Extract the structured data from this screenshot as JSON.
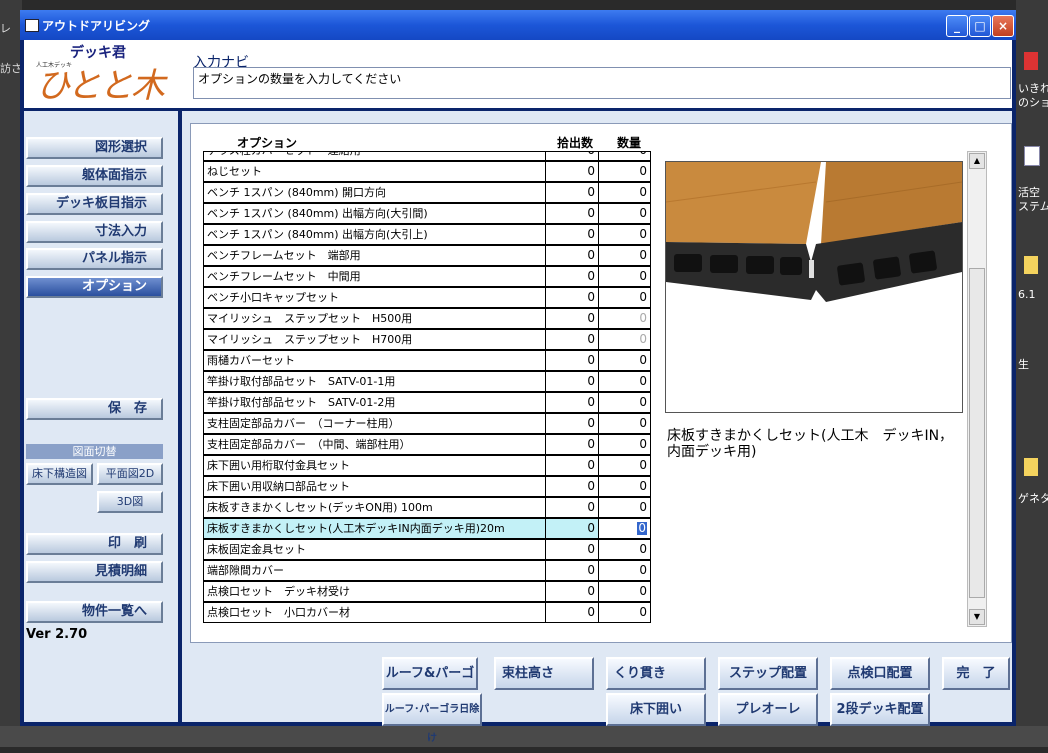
{
  "desktop": {
    "left_labels": [
      "レ",
      "訪さ"
    ],
    "right_labels": [
      "いきれ",
      "のショ",
      "活空",
      "ステム",
      "6.1",
      "生",
      "ゲネタ"
    ]
  },
  "window": {
    "title": "アウトドアリビング",
    "controls": {
      "minimize": "_",
      "maximize": "□",
      "close": "×"
    }
  },
  "logo": {
    "product": "デッキ君",
    "sub": "人工木デッキ",
    "brand": "ひとと木"
  },
  "navi": {
    "title": "入力ナビ",
    "message": "オプションの数量を入力してください"
  },
  "sidebar": {
    "buttons": [
      "図形選択",
      "躯体面指示",
      "デッキ板目指示",
      "寸法入力",
      "パネル指示",
      "オプション"
    ],
    "active": "オプション",
    "save": "保　存",
    "view_label": "図面切替",
    "view_buttons": [
      "床下構造図",
      "平面図2D",
      "3D図"
    ],
    "print": "印　刷",
    "estimate": "見積明細",
    "list": "物件一覧へ",
    "version": "Ver 2.70"
  },
  "table": {
    "headers": {
      "option": "オプション",
      "pick": "拾出数",
      "qty": "数量"
    },
    "rows": [
      {
        "name": "テラス柱カバーセット　連結用",
        "pick": "0",
        "qty": "0"
      },
      {
        "name": "ねじセット",
        "pick": "0",
        "qty": "0"
      },
      {
        "name": "ベンチ 1スパン (840mm) 開口方向",
        "pick": "0",
        "qty": "0"
      },
      {
        "name": "ベンチ 1スパン (840mm) 出幅方向(大引間)",
        "pick": "0",
        "qty": "0"
      },
      {
        "name": "ベンチ 1スパン (840mm) 出幅方向(大引上)",
        "pick": "0",
        "qty": "0"
      },
      {
        "name": "ベンチフレームセット　端部用",
        "pick": "0",
        "qty": "0"
      },
      {
        "name": "ベンチフレームセット　中間用",
        "pick": "0",
        "qty": "0"
      },
      {
        "name": "ベンチ小口キャップセット",
        "pick": "0",
        "qty": "0"
      },
      {
        "name": "マイリッシュ　ステップセット　H500用",
        "pick": "0",
        "qty": "0"
      },
      {
        "name": "マイリッシュ　ステップセット　H700用",
        "pick": "0",
        "qty": "0"
      },
      {
        "name": "雨樋カバーセット",
        "pick": "0",
        "qty": "0"
      },
      {
        "name": "竿掛け取付部品セット　SATV-01-1用",
        "pick": "0",
        "qty": "0"
      },
      {
        "name": "竿掛け取付部品セット　SATV-01-2用",
        "pick": "0",
        "qty": "0"
      },
      {
        "name": "支柱固定部品カバー　（コーナー柱用）",
        "pick": "0",
        "qty": "0"
      },
      {
        "name": "支柱固定部品カバー　（中間、端部柱用）",
        "pick": "0",
        "qty": "0"
      },
      {
        "name": "床下囲い用桁取付金具セット",
        "pick": "0",
        "qty": "0"
      },
      {
        "name": "床下囲い用収納口部品セット",
        "pick": "0",
        "qty": "0"
      },
      {
        "name": "床板すきまかくしセット(デッキON用) 100m",
        "pick": "0",
        "qty": "0"
      },
      {
        "name": "床板すきまかくしセット(人工木デッキIN内面デッキ用)20m",
        "pick": "0",
        "qty": "0"
      },
      {
        "name": "床板固定金具セット",
        "pick": "0",
        "qty": "0"
      },
      {
        "name": "端部隙間カバー",
        "pick": "0",
        "qty": "0"
      },
      {
        "name": "点検口セット　デッキ材受け",
        "pick": "0",
        "qty": "0"
      },
      {
        "name": "点検口セット　小口カバー材",
        "pick": "0",
        "qty": "0"
      }
    ]
  },
  "preview": {
    "caption": "床板すきまかくしセット(人工木　デッキIN，内面デッキ用)"
  },
  "bottom_buttons": {
    "roof": "ルーフ&パーゴラ",
    "post": "束柱高さ",
    "kuri": "くり貫き",
    "step": "ステップ配置",
    "tenken": "点検口配置",
    "done": "完　了",
    "shade": "ルーフ･パーゴラ日除け",
    "yukashita": "床下囲い",
    "pleore": "プレオーレ",
    "two_step": "2段デッキ配置"
  },
  "colors": {
    "title_bar": "#1c56d8",
    "frame": "#0a246a",
    "selected_row": "#c3f1f7",
    "board": "#c98a3e"
  }
}
